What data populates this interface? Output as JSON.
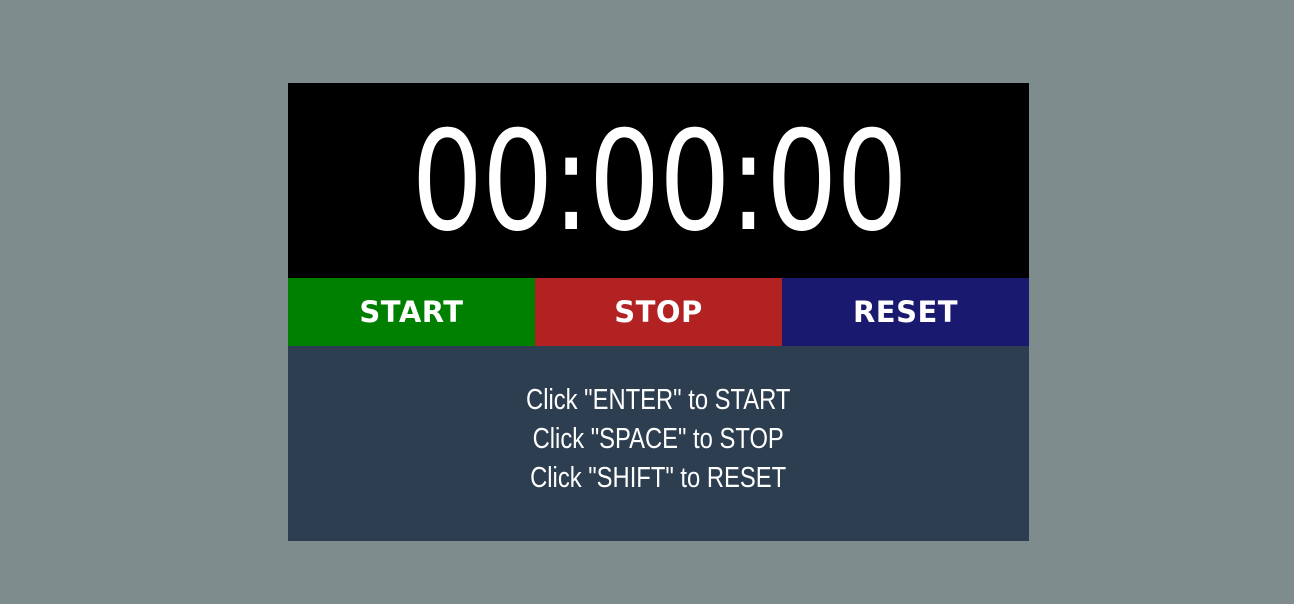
{
  "stopwatch": {
    "time": "00:00:00",
    "buttons": {
      "start": "START",
      "stop": "STOP",
      "reset": "RESET"
    },
    "instructions": [
      "Click \"ENTER\" to START",
      "Click \"SPACE\" to STOP",
      "Click \"SHIFT\" to RESET"
    ]
  },
  "colors": {
    "page_background": "#7f8c8d",
    "display_background": "#000000",
    "start_button": "#008000",
    "stop_button": "#b22222",
    "reset_button": "#191970",
    "help_background": "#2c3e50",
    "text": "#ffffff"
  }
}
